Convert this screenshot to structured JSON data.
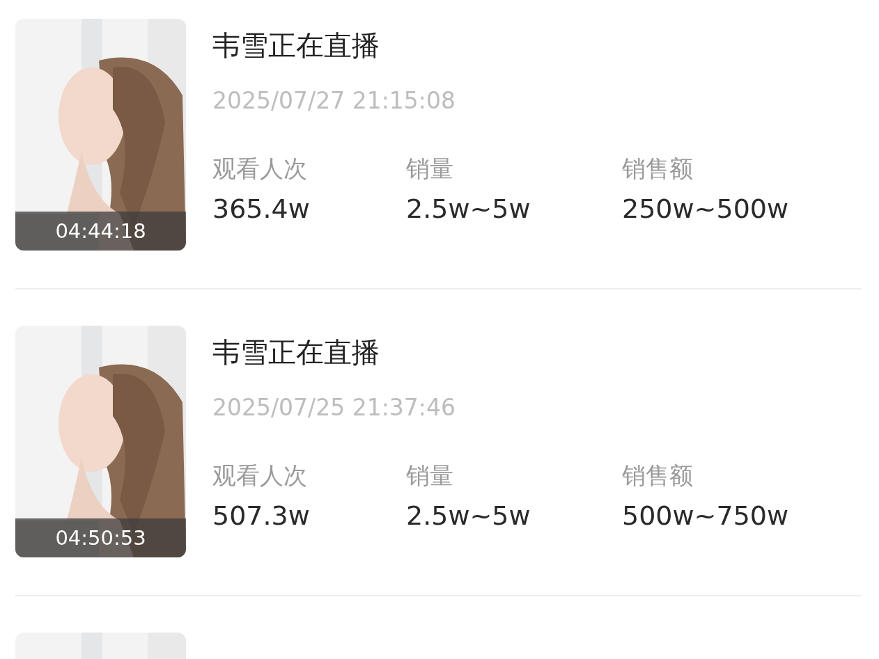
{
  "items": [
    {
      "title": "韦雪正在直播",
      "time": "2025/07/27 21:15:08",
      "thumbnail": {
        "kind": "picture",
        "duration": "04:44:18"
      },
      "stats": [
        {
          "label": "观看人次",
          "value": "365.4w"
        },
        {
          "label": "销量",
          "value": "2.5w~5w"
        },
        {
          "label": "销售额",
          "value": "250w~500w"
        }
      ]
    },
    {
      "title": "韦雪正在直播",
      "time": "2025/07/25 21:37:46",
      "thumbnail": {
        "kind": "picture",
        "duration": "04:50:53"
      },
      "stats": [
        {
          "label": "观看人次",
          "value": "507.3w"
        },
        {
          "label": "销量",
          "value": "2.5w~5w"
        },
        {
          "label": "销售额",
          "value": "500w~750w"
        }
      ]
    },
    {
      "thumbnail": {
        "kind": "picture"
      }
    }
  ]
}
